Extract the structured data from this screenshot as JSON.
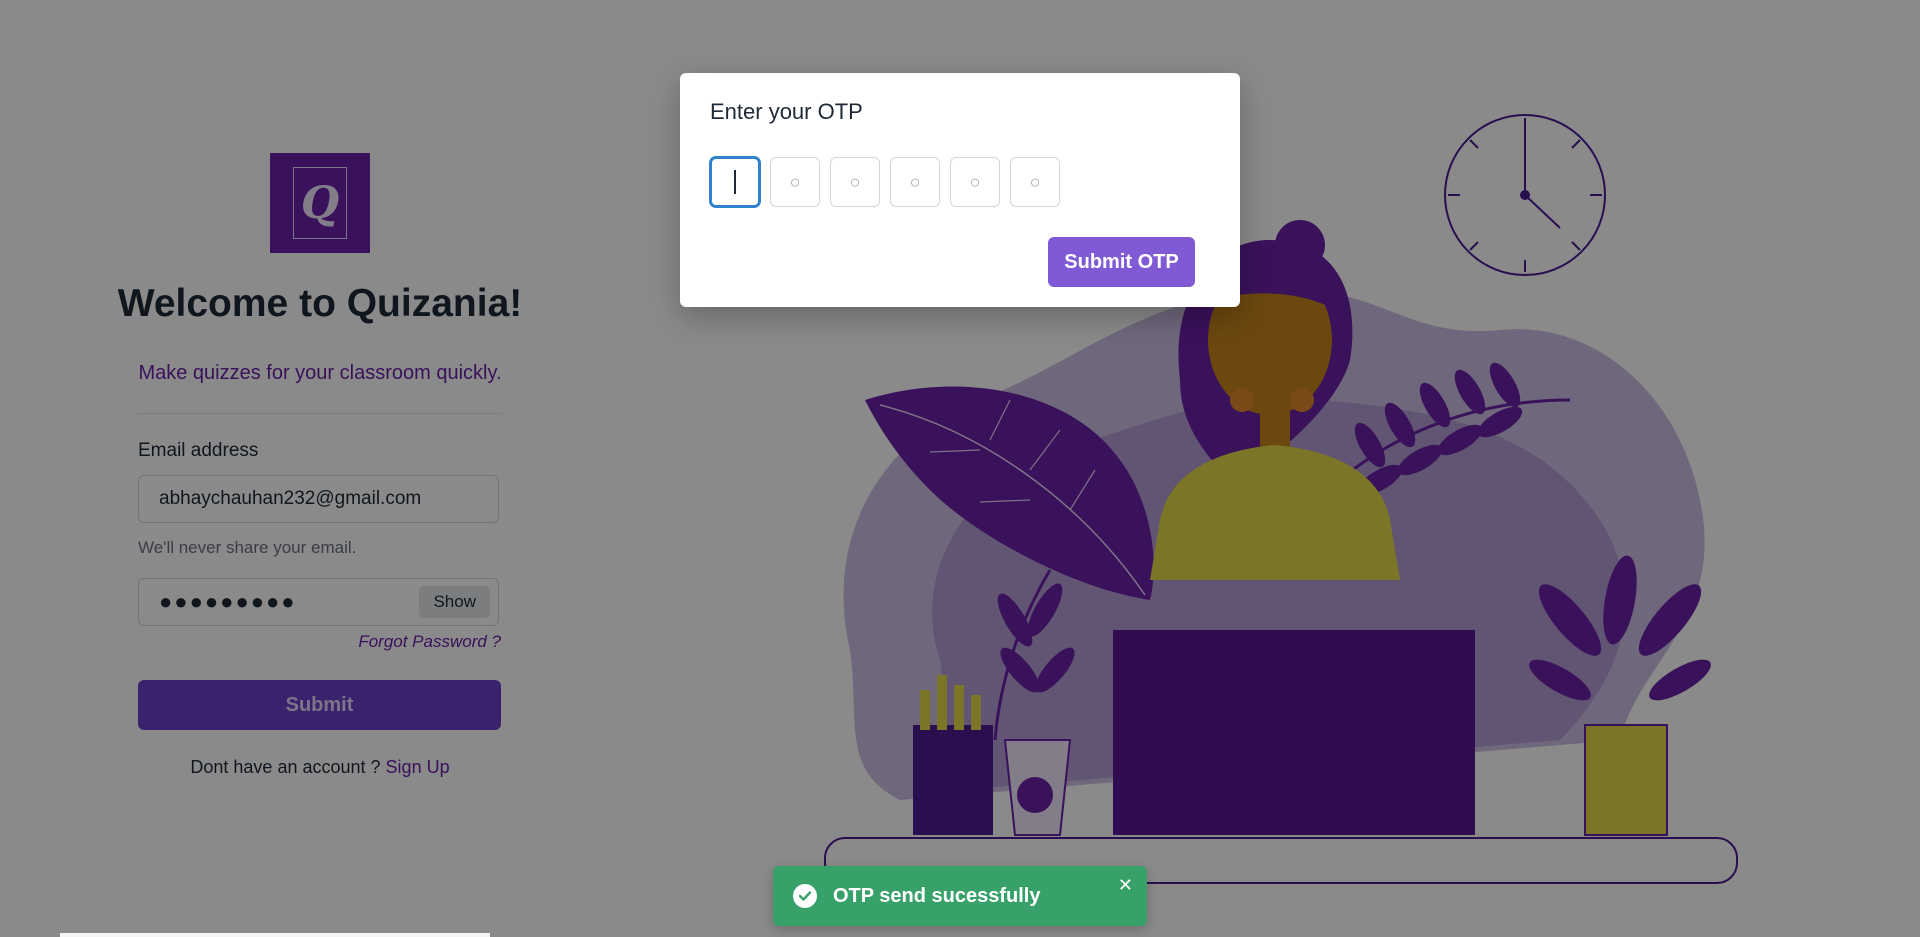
{
  "login": {
    "logo_letter": "Q",
    "title": "Welcome to Quizania!",
    "tagline": "Make quizzes for your classroom quickly.",
    "email_label": "Email address",
    "email_value": "abhaychauhan232@gmail.com",
    "email_helper": "We'll never share your email.",
    "password_value": "●●●●●●●●●",
    "show_label": "Show",
    "forgot_label": "Forgot Password ?",
    "submit_label": "Submit",
    "signup_prompt": "Dont have an account ?",
    "signup_link": "Sign Up"
  },
  "modal": {
    "title": "Enter your OTP",
    "otp_placeholder": "○",
    "submit_label": "Submit OTP"
  },
  "toast": {
    "message": "OTP send sucessfully",
    "icon": "check-circle-icon",
    "close_icon": "close-icon"
  },
  "colors": {
    "brand_purple": "#6b21a8",
    "modal_button": "#805ad5",
    "toast_green": "#38a169",
    "overlay": "rgba(0,0,0,0.46)"
  }
}
